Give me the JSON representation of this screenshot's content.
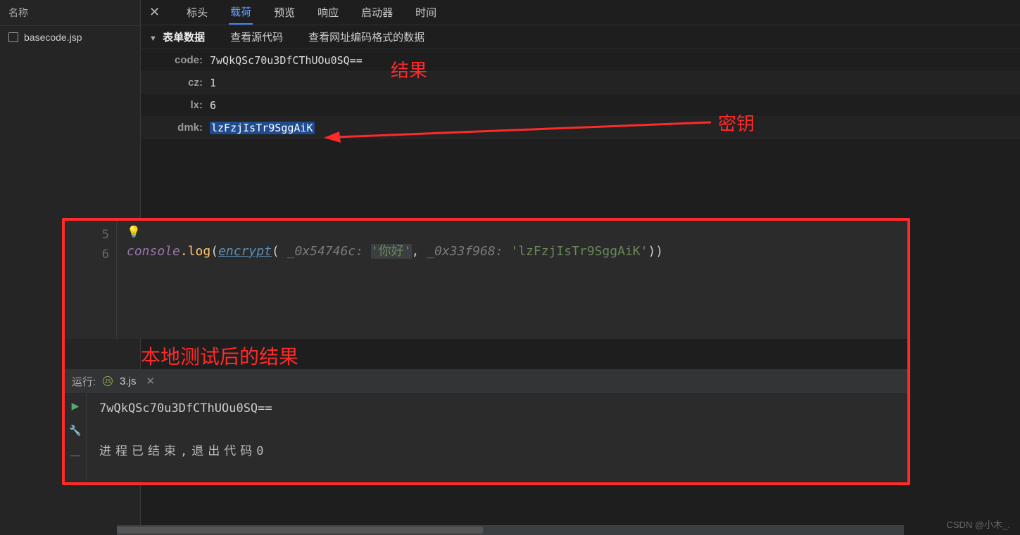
{
  "sidebar": {
    "header_label": "名称",
    "file_name": "basecode.jsp"
  },
  "tabs": {
    "t0": "标头",
    "t1": "载荷",
    "t2": "预览",
    "t3": "响应",
    "t4": "启动器",
    "t5": "时间"
  },
  "section": {
    "form_data_label": "表单数据",
    "view_source_label": "查看源代码",
    "view_url_encoded_label": "查看网址编码格式的数据"
  },
  "form": {
    "k_code": "code:",
    "v_code": "7wQkQSc70u3DfCThUOu0SQ==",
    "k_cz": "cz:",
    "v_cz": "1",
    "k_lx": "lx:",
    "v_lx": "6",
    "k_dmk": "dmk:",
    "v_dmk": "lzFzjIsTr9SggAiK"
  },
  "annotations": {
    "result_label": "结果",
    "key_label": "密钥",
    "local_test_label": "本地测试后的结果"
  },
  "editor": {
    "gutter_line_a": "5",
    "gutter_line_b": "6",
    "console_token": "console",
    "log_token": ".log",
    "open_paren": "(",
    "encrypt_token": "encrypt",
    "open_paren2": "(",
    "hint1": " _0x54746c: ",
    "arg1": "'你好'",
    "comma": ",",
    "hint2": " _0x33f968: ",
    "arg2": "'lzFzjIsTr9SggAiK'",
    "close": "))"
  },
  "runner": {
    "run_prefix": "运行:",
    "file_label": "3.js"
  },
  "console_out": {
    "line1": "7wQkQSc70u3DfCThUOu0SQ==",
    "exit_line": "进程已结束,退出代码0"
  },
  "footer": "CSDN @小木_."
}
